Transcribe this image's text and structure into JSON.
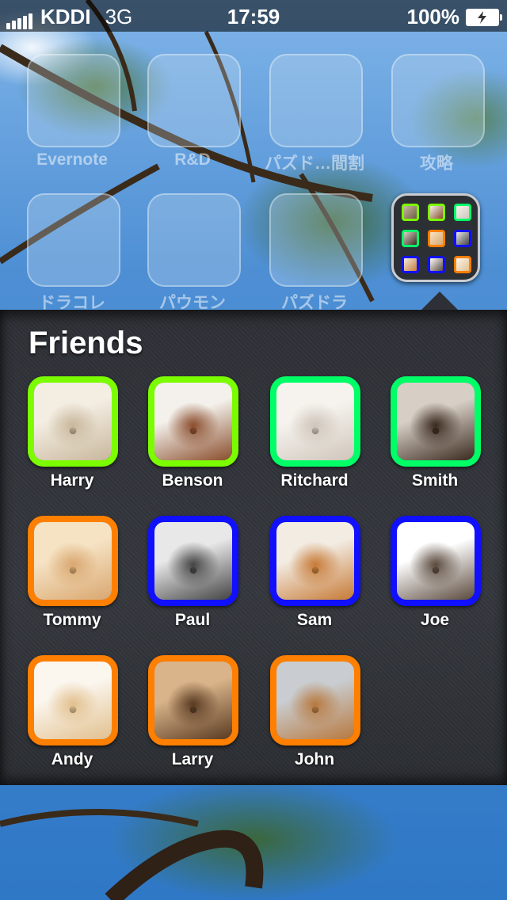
{
  "status_bar": {
    "carrier": "KDDI",
    "network": "3G",
    "time": "17:59",
    "battery": "100%"
  },
  "home_screen": {
    "apps": [
      {
        "label": "Evernote"
      },
      {
        "label": "R&D"
      },
      {
        "label": "パズド…間割"
      },
      {
        "label": "攻略"
      },
      {
        "label": "ドラコレ"
      },
      {
        "label": "パウモン"
      },
      {
        "label": "パズドラ"
      }
    ]
  },
  "folder": {
    "title": "Friends",
    "apps": [
      {
        "label": "Harry",
        "border_color": "#7cfc00",
        "photo_colors": [
          "#f3ede2",
          "#c9b79c"
        ]
      },
      {
        "label": "Benson",
        "border_color": "#7cfc00",
        "photo_colors": [
          "#f4f1ec",
          "#8a4d2c"
        ]
      },
      {
        "label": "Ritchard",
        "border_color": "#00ff66",
        "photo_colors": [
          "#f6f3ee",
          "#cfc6bb"
        ]
      },
      {
        "label": "Smith",
        "border_color": "#00ff66",
        "photo_colors": [
          "#d7cfc6",
          "#3a2a1e"
        ]
      },
      {
        "label": "Tommy",
        "border_color": "#ff7f00",
        "photo_colors": [
          "#f6e3c4",
          "#d9a770"
        ]
      },
      {
        "label": "Paul",
        "border_color": "#1010ff",
        "photo_colors": [
          "#e8e8e8",
          "#444444"
        ]
      },
      {
        "label": "Sam",
        "border_color": "#1010ff",
        "photo_colors": [
          "#f2ece3",
          "#c77a36"
        ]
      },
      {
        "label": "Joe",
        "border_color": "#1010ff",
        "photo_colors": [
          "#ffffff",
          "#5b4a3d"
        ]
      },
      {
        "label": "Andy",
        "border_color": "#ff7f00",
        "photo_colors": [
          "#fbf6ee",
          "#e2c08e"
        ]
      },
      {
        "label": "Larry",
        "border_color": "#ff7f00",
        "photo_colors": [
          "#d9b48a",
          "#5a3b22"
        ]
      },
      {
        "label": "John",
        "border_color": "#ff7f00",
        "photo_colors": [
          "#c9cdd1",
          "#b8793f"
        ]
      }
    ]
  }
}
